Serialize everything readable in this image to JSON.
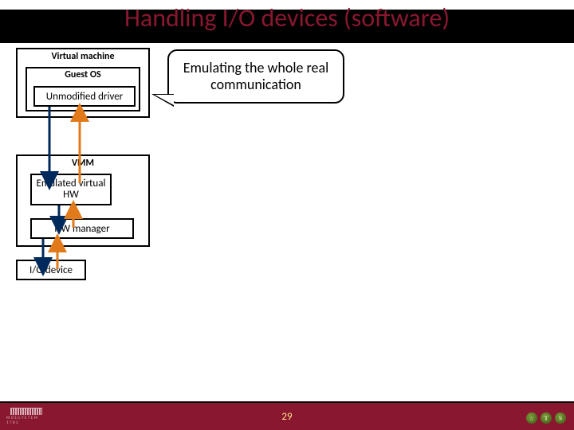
{
  "title": "Handling I/O devices (software)",
  "vm": {
    "outer_label": "Virtual machine",
    "guest_label": "Guest OS",
    "driver_label": "Unmodified driver"
  },
  "vmm": {
    "outer_label": "VMM",
    "emu_hw_label": "Emulated\nvirtual HW",
    "hw_mgr_label": "HW manager"
  },
  "io_device_label": "I/O device",
  "callout": "Emulating the whole real communication",
  "page_number": "29",
  "logo_left_text": "MŰEGYETEM 1782",
  "colors": {
    "brand": "#8a1730",
    "accent": "#ffe28a"
  }
}
